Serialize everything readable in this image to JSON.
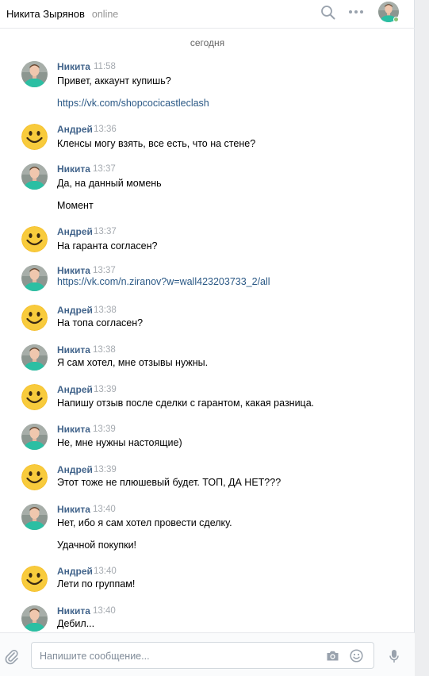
{
  "header": {
    "peer_name": "Никита Зырянов",
    "peer_status": "online"
  },
  "history": {
    "date_separator": "сегодня",
    "messages": [
      {
        "author": "Никита",
        "time": "11:58",
        "avatar": "nikita-photo",
        "lines": [
          {
            "text": "Привет, аккаунт купишь?",
            "link": false
          },
          {
            "text": "https://vk.com/shopcocicastleclash",
            "link": true
          }
        ]
      },
      {
        "author": "Андрей",
        "time": "13:36",
        "avatar": "smiley-face",
        "lines": [
          {
            "text": "Кленсы могу взять, все есть, что на стене?",
            "link": false
          }
        ]
      },
      {
        "author": "Никита",
        "time": "13:37",
        "avatar": "nikita-photo",
        "lines": [
          {
            "text": "Да, на данный момень",
            "link": false
          },
          {
            "text": "Момент",
            "link": false
          }
        ]
      },
      {
        "author": "Андрей",
        "time": "13:37",
        "avatar": "smiley-face",
        "lines": [
          {
            "text": "На гаранта согласен?",
            "link": false
          }
        ]
      },
      {
        "author": "Никита",
        "time": "13:37",
        "avatar": "nikita-photo",
        "lines": [
          {
            "text": "https://vk.com/n.ziranov?w=wall423203733_2/all",
            "link": true
          }
        ]
      },
      {
        "author": "Андрей",
        "time": "13:38",
        "avatar": "smiley-face",
        "lines": [
          {
            "text": "На топа согласен?",
            "link": false
          }
        ]
      },
      {
        "author": "Никита",
        "time": "13:38",
        "avatar": "nikita-photo",
        "lines": [
          {
            "text": "Я сам хотел, мне отзывы нужны.",
            "link": false
          }
        ]
      },
      {
        "author": "Андрей",
        "time": "13:39",
        "avatar": "smiley-face",
        "lines": [
          {
            "text": "Напишу отзыв после сделки с гарантом, какая разница.",
            "link": false
          }
        ]
      },
      {
        "author": "Никита",
        "time": "13:39",
        "avatar": "nikita-photo",
        "lines": [
          {
            "text": "Не, мне нужны настоящие)",
            "link": false
          }
        ]
      },
      {
        "author": "Андрей",
        "time": "13:39",
        "avatar": "smiley-face",
        "lines": [
          {
            "text": "Этот тоже не плюшевый будет. ТОП, ДА НЕТ???",
            "link": false
          }
        ]
      },
      {
        "author": "Никита",
        "time": "13:40",
        "avatar": "nikita-photo",
        "lines": [
          {
            "text": "Нет, ибо я сам хотел провести сделку.",
            "link": false
          },
          {
            "text": "Удачной покупки!",
            "link": false
          }
        ]
      },
      {
        "author": "Андрей",
        "time": "13:40",
        "avatar": "smiley-face",
        "lines": [
          {
            "text": "Лети по группам!",
            "link": false
          }
        ]
      },
      {
        "author": "Никита",
        "time": "13:40",
        "avatar": "nikita-photo",
        "lines": [
          {
            "text": "Дебил...",
            "link": false
          }
        ]
      }
    ]
  },
  "composer": {
    "placeholder": "Напишите сообщение..."
  },
  "icons": {
    "search": "search-icon",
    "more": "more-dots-icon",
    "attach": "paperclip-icon",
    "camera": "camera-icon",
    "emoji": "emoji-smile-icon",
    "mic": "microphone-icon"
  },
  "colors": {
    "author_name": "#42648b",
    "link": "#2a5885",
    "time": "#a5aab0",
    "online": "#8ac176",
    "avatar_shirt": "#2bbfa3",
    "smiley": "#f5c02f"
  }
}
